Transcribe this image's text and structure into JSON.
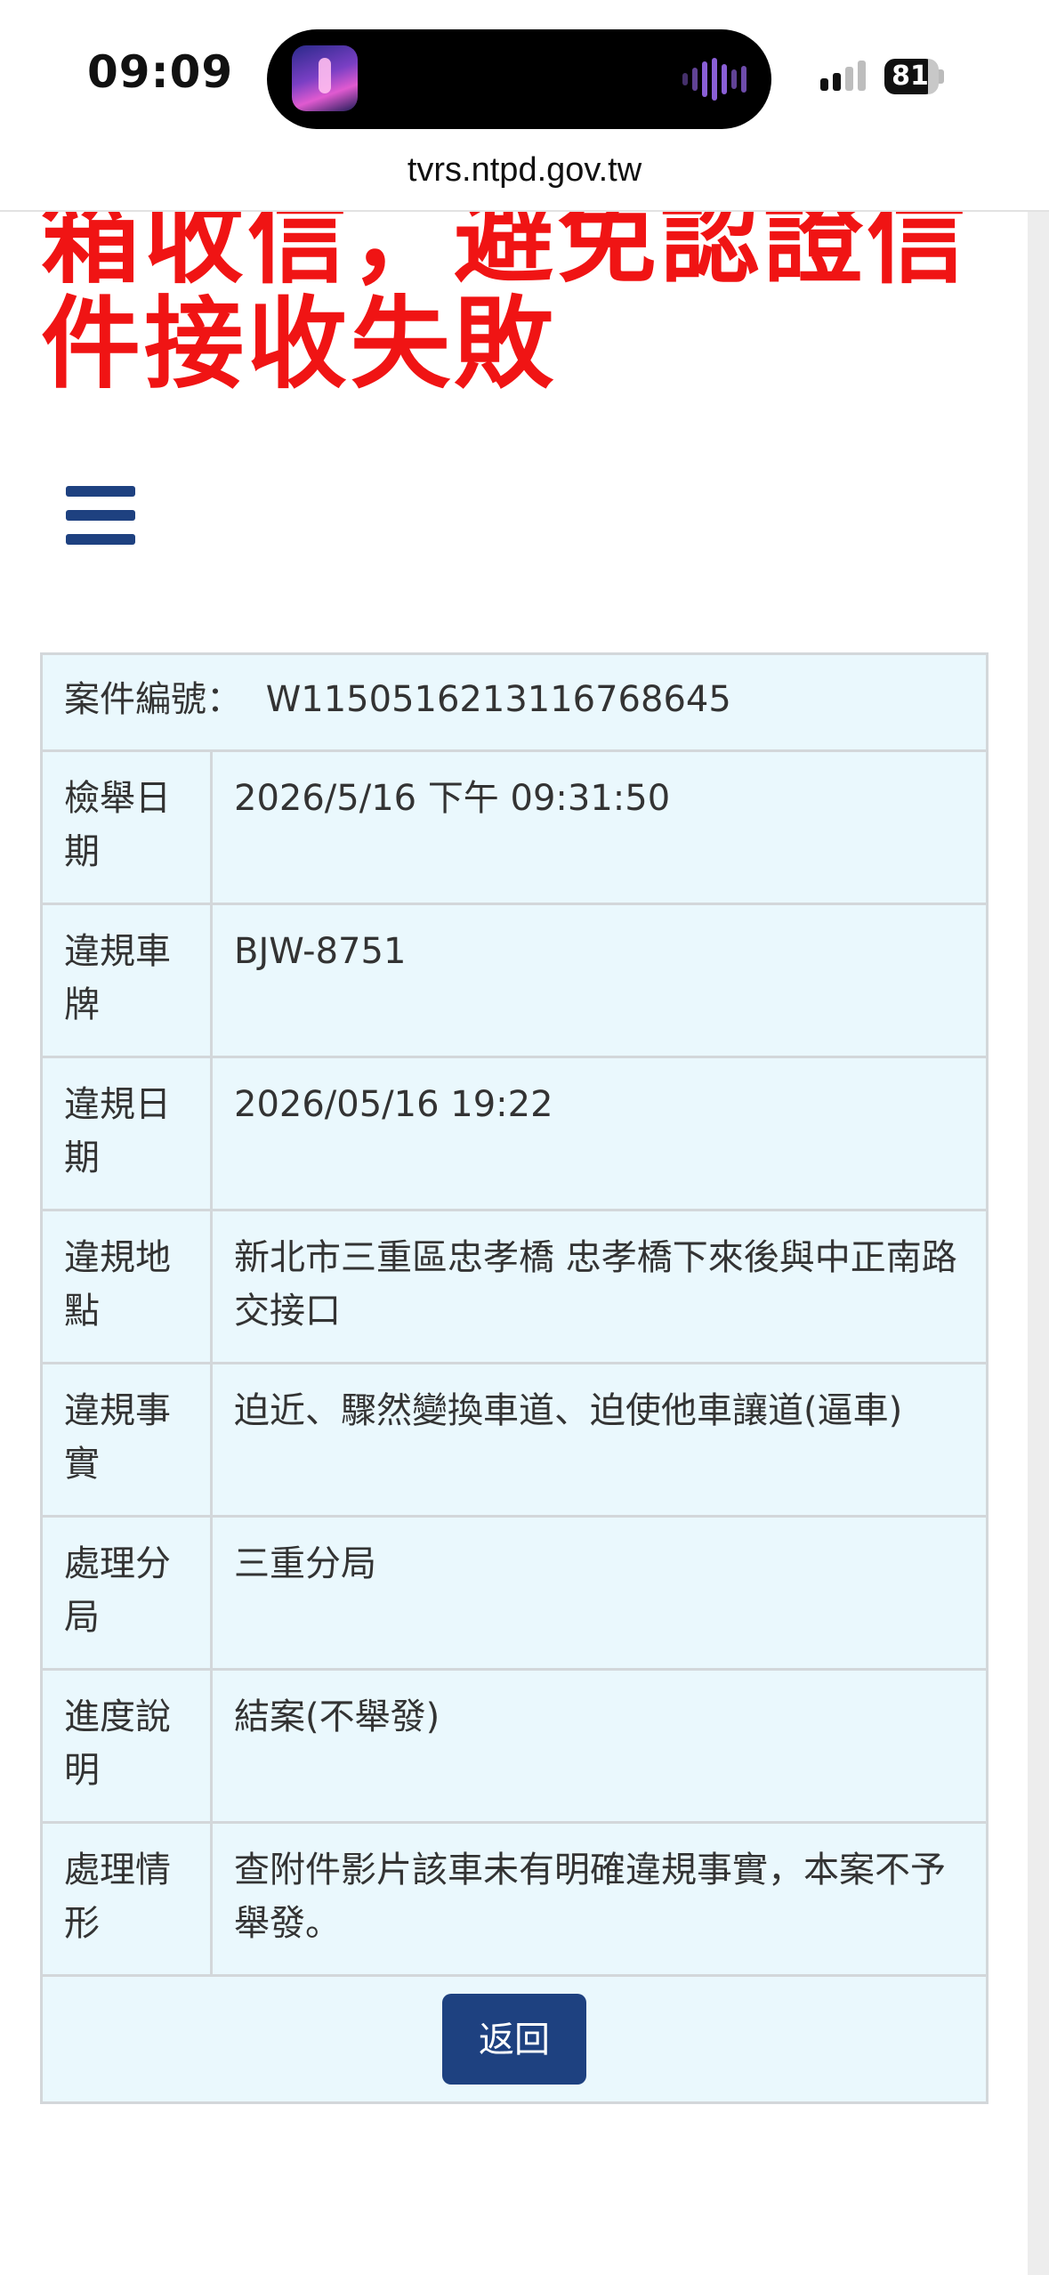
{
  "status_bar": {
    "time": "09:09",
    "battery": "81"
  },
  "browser": {
    "url": "tvrs.ntpd.gov.tw"
  },
  "notice": {
    "line1": "箱收信，避免認證信",
    "line2": "件接收失敗",
    "color": "#f01414"
  },
  "case": {
    "number_label": "案件編號：",
    "number_value": "W1150516213116768645",
    "rows": [
      {
        "label": "檢舉日期",
        "value": "2026/5/16 下午 09:31:50"
      },
      {
        "label": "違規車牌",
        "value": "BJW-8751"
      },
      {
        "label": "違規日期",
        "value": "2026/05/16 19:22"
      },
      {
        "label": "違規地點",
        "value": "新北市三重區忠孝橋 忠孝橋下來後與中正南路交接口"
      },
      {
        "label": "違規事實",
        "value": "迫近、驟然變換車道、迫使他車讓道(逼車)"
      },
      {
        "label": "處理分局",
        "value": "三重分局"
      },
      {
        "label": "進度說明",
        "value": "結案(不舉發)"
      },
      {
        "label": "處理情形",
        "value": "查附件影片該車未有明確違規事實，本案不予舉發。"
      }
    ]
  },
  "actions": {
    "back_label": "返回"
  },
  "colors": {
    "primary": "#1e4180",
    "table_bg": "#eaf8fd",
    "border": "#d3d7da"
  }
}
